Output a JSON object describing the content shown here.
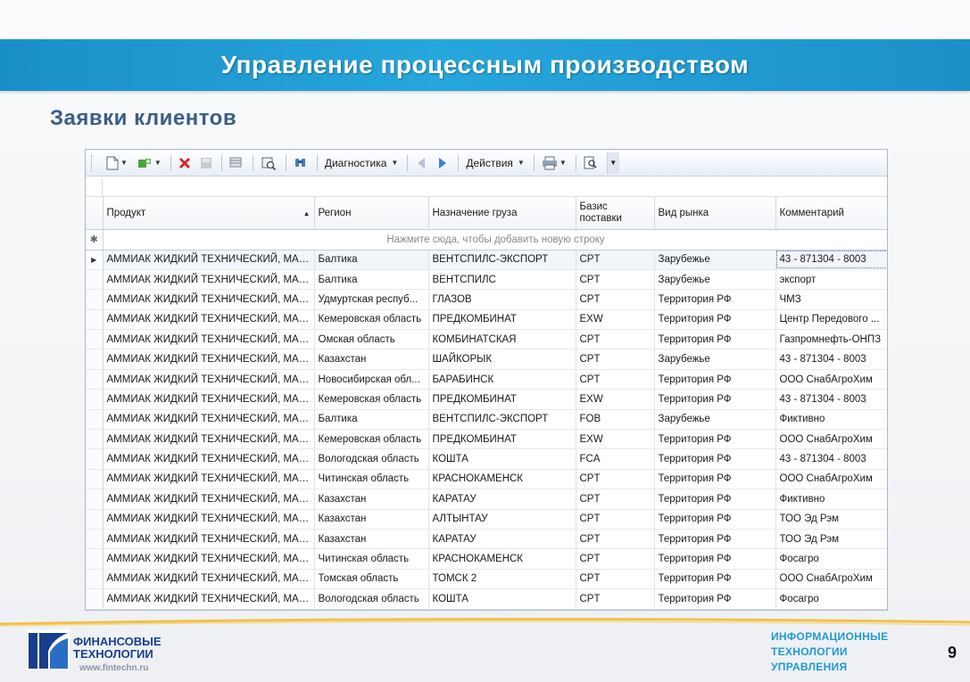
{
  "slide": {
    "title": "Управление процессным производством",
    "subtitle": "Заявки клиентов",
    "page_number": "9"
  },
  "toolbar": {
    "diagnostics_label": "Диагностика",
    "actions_label": "Действия"
  },
  "grid": {
    "columns": [
      "Продукт",
      "Регион",
      "Назначение груза",
      "Базис поставки",
      "Вид рынка",
      "Комментарий"
    ],
    "sorted_column": "Продукт",
    "new_row_placeholder": "Нажмите сюда, чтобы добавить новую строку",
    "rows": [
      [
        "АММИАК ЖИДКИЙ ТЕХНИЧЕСКИЙ, МАР...",
        "Балтика",
        "ВЕНТСПИЛС-ЭКСПОРТ",
        "CPT",
        "Зарубежье",
        "43 - 871304 - 8003"
      ],
      [
        "АММИАК ЖИДКИЙ ТЕХНИЧЕСКИЙ, МАР...",
        "Балтика",
        "ВЕНТСПИЛС",
        "CPT",
        "Зарубежье",
        "экспорт"
      ],
      [
        "АММИАК ЖИДКИЙ ТЕХНИЧЕСКИЙ, МАР...",
        "Удмуртская респуб...",
        "ГЛАЗОВ",
        "CPT",
        "Территория РФ",
        "ЧМЗ"
      ],
      [
        "АММИАК ЖИДКИЙ ТЕХНИЧЕСКИЙ, МАР...",
        "Кемеровская область",
        "ПРЕДКОМБИНАТ",
        "EXW",
        "Территория РФ",
        "Центр Передового ..."
      ],
      [
        "АММИАК ЖИДКИЙ ТЕХНИЧЕСКИЙ, МАР...",
        "Омская область",
        "КОМБИНАТСКАЯ",
        "CPT",
        "Территория РФ",
        "Газпромнефть-ОНПЗ"
      ],
      [
        "АММИАК ЖИДКИЙ ТЕХНИЧЕСКИЙ, МАР...",
        "Казахстан",
        "ШАЙКОРЫК",
        "CPT",
        "Зарубежье",
        "43 - 871304 - 8003"
      ],
      [
        "АММИАК ЖИДКИЙ ТЕХНИЧЕСКИЙ, МАР...",
        "Новосибирская обл...",
        "БАРАБИНСК",
        "CPT",
        "Территория РФ",
        "ООО СнабАгроХим"
      ],
      [
        "АММИАК ЖИДКИЙ ТЕХНИЧЕСКИЙ, МАР...",
        "Кемеровская область",
        "ПРЕДКОМБИНАТ",
        "EXW",
        "Территория РФ",
        "43 - 871304 - 8003"
      ],
      [
        "АММИАК ЖИДКИЙ ТЕХНИЧЕСКИЙ, МАР...",
        "Балтика",
        "ВЕНТСПИЛС-ЭКСПОРТ",
        "FOB",
        "Зарубежье",
        "Фиктивно"
      ],
      [
        "АММИАК ЖИДКИЙ ТЕХНИЧЕСКИЙ, МАР...",
        "Кемеровская область",
        "ПРЕДКОМБИНАТ",
        "EXW",
        "Территория РФ",
        "ООО СнабАгроХим"
      ],
      [
        "АММИАК ЖИДКИЙ ТЕХНИЧЕСКИЙ, МАР...",
        "Вологодская область",
        "КОШТА",
        "FCA",
        "Территория РФ",
        "43 - 871304 - 8003"
      ],
      [
        "АММИАК ЖИДКИЙ ТЕХНИЧЕСКИЙ, МАР...",
        "Читинская область",
        "КРАСНОКАМЕНСК",
        "CPT",
        "Территория РФ",
        "ООО СнабАгроХим"
      ],
      [
        "АММИАК ЖИДКИЙ ТЕХНИЧЕСКИЙ, МАР...",
        "Казахстан",
        "КАРАТАУ",
        "CPT",
        "Территория РФ",
        "Фиктивно"
      ],
      [
        "АММИАК ЖИДКИЙ ТЕХНИЧЕСКИЙ, МАР...",
        "Казахстан",
        "АЛТЫНТАУ",
        "CPT",
        "Территория РФ",
        "ТОО Эд Рэм"
      ],
      [
        "АММИАК ЖИДКИЙ ТЕХНИЧЕСКИЙ, МАР...",
        "Казахстан",
        "КАРАТАУ",
        "CPT",
        "Территория РФ",
        "ТОО Эд Рэм"
      ],
      [
        "АММИАК ЖИДКИЙ ТЕХНИЧЕСКИЙ, МАР...",
        "Читинская область",
        "КРАСНОКАМЕНСК",
        "CPT",
        "Территория РФ",
        "Фосагро"
      ],
      [
        "АММИАК ЖИДКИЙ ТЕХНИЧЕСКИЙ, МАР...",
        "Томская область",
        "ТОМСК 2",
        "CPT",
        "Территория РФ",
        "ООО СнабАгроХим"
      ],
      [
        "АММИАК ЖИДКИЙ ТЕХНИЧЕСКИЙ, МАР...",
        "Вологодская область",
        "КОШТА",
        "CPT",
        "Территория РФ",
        "Фосагро"
      ]
    ]
  },
  "footer": {
    "company_line1": "ФИНАНСОВЫЕ",
    "company_line2": "ТЕХНОЛОГИИ",
    "website": "www.fintechn.ru",
    "it_line1": "ИНФОРМАЦИОННЫЕ",
    "it_line2": "ТЕХНОЛОГИИ",
    "it_line3": "УПРАВЛЕНИЯ"
  },
  "colors": {
    "banner": "#1f9bd4",
    "subtitle": "#3a5f87",
    "logo_blue": "#1a3e8c",
    "it_blue": "#1e9ad6",
    "footer_swoosh": "#f0c24a"
  }
}
